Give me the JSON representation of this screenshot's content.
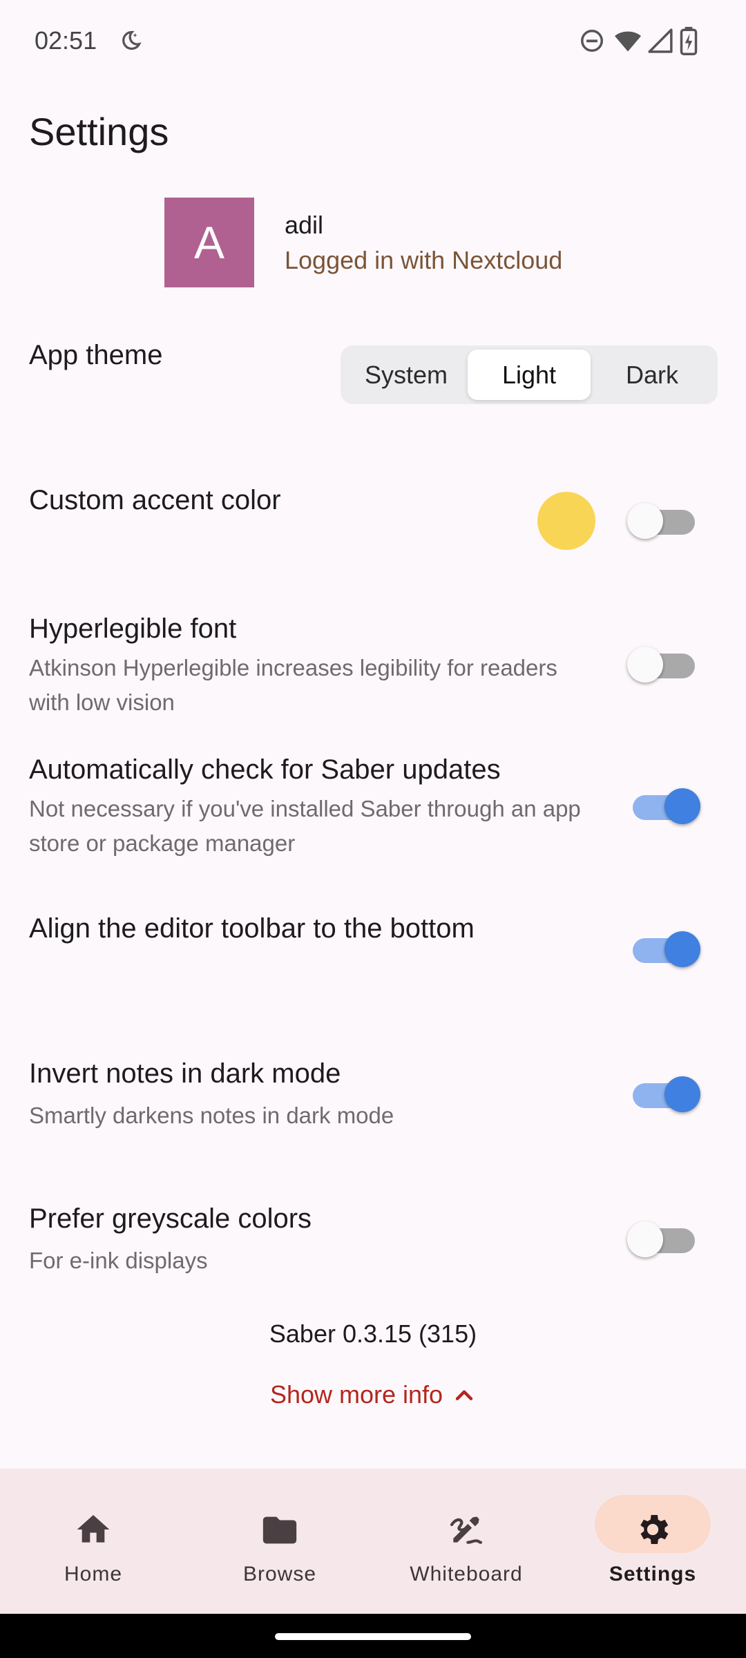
{
  "status_bar": {
    "time": "02:51"
  },
  "page": {
    "title": "Settings"
  },
  "account": {
    "initial": "A",
    "name": "adil",
    "status": "Logged in with Nextcloud"
  },
  "theme": {
    "title": "App theme",
    "options": [
      "System",
      "Light",
      "Dark"
    ],
    "selected": "Light"
  },
  "settings": {
    "accent": {
      "title": "Custom accent color",
      "color": "#f8d554",
      "enabled": false
    },
    "hyperlegible": {
      "title": "Hyperlegible font",
      "subtitle": "Atkinson Hyperlegible increases legibility for readers with low vision",
      "enabled": false
    },
    "updates": {
      "title": "Automatically check for Saber updates",
      "subtitle": "Not necessary if you've installed Saber through an app store or package manager",
      "enabled": true
    },
    "toolbar": {
      "title": "Align the editor toolbar to the bottom",
      "enabled": true
    },
    "invert": {
      "title": "Invert notes in dark mode",
      "subtitle": "Smartly darkens notes in dark mode",
      "enabled": true
    },
    "greyscale": {
      "title": "Prefer greyscale colors",
      "subtitle": "For e-ink displays",
      "enabled": false
    }
  },
  "footer": {
    "version": "Saber 0.3.15 (315)",
    "more_info": "Show more info"
  },
  "nav": {
    "items": [
      {
        "label": "Home",
        "icon": "home-icon"
      },
      {
        "label": "Browse",
        "icon": "folder-icon"
      },
      {
        "label": "Whiteboard",
        "icon": "draw-icon"
      },
      {
        "label": "Settings",
        "icon": "gear-icon"
      }
    ],
    "active": "Settings"
  },
  "colors": {
    "accent_link": "#b3261e",
    "toggle_on": "#3f80e0",
    "avatar_bg": "#b06191"
  }
}
